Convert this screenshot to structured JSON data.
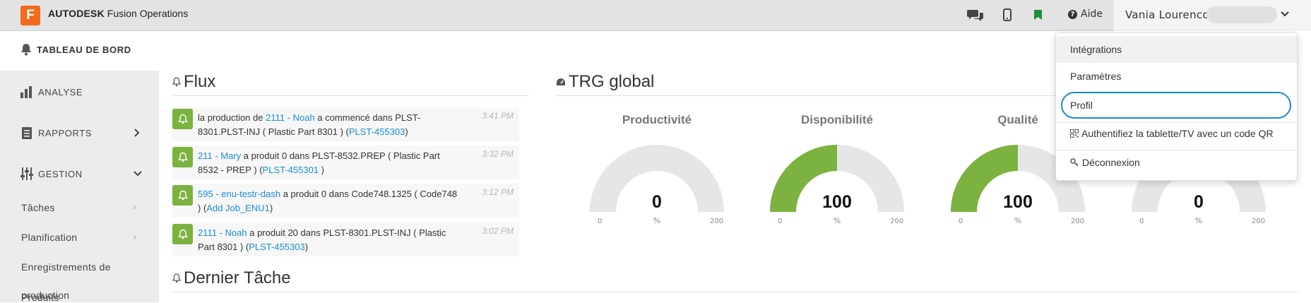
{
  "app": {
    "logo_letter": "F",
    "brand_bold": "AUTODESK",
    "brand_rest": " Fusion Operations"
  },
  "topbar": {
    "help_label": "Aide",
    "user_name": "Vania Lourenco",
    "icons": [
      "chat-icon",
      "mobile-icon",
      "bookmark-icon",
      "help-icon",
      "chevron-down-icon"
    ]
  },
  "sidebar": {
    "dashboard": "TABLEAU DE BORD",
    "analyse": "ANALYSE",
    "rapports": "RAPPORTS",
    "gestion": "GESTION",
    "sub": [
      "Tâches",
      "Planification",
      "Enregistrements de",
      "production",
      "Produits"
    ]
  },
  "feed": {
    "title": "Flux",
    "items": [
      {
        "pre": "la production de ",
        "link1": "2111 - Noah",
        "mid": " a commencé dans PLST-8301.PLST-INJ ( Plastic Part 8301 ) (",
        "link2": "PLST-455303",
        "post": ")",
        "time": "3:41 PM"
      },
      {
        "pre": "",
        "link1": "211 - Mary",
        "mid": " a produit 0 dans PLST-8532.PREP ( Plastic Part 8532 - PREP ) (",
        "link2": "PLST-455301",
        "post": " )",
        "time": "3:32 PM"
      },
      {
        "pre": "",
        "link1": "595 - enu-testr-dash",
        "mid": " a produit 0 dans Code748.1325 ( Code748 ) (",
        "link2": "Add Job_ENU1",
        "post": ")",
        "time": "3:12 PM"
      },
      {
        "pre": "",
        "link1": "2111 - Noah",
        "mid": " a produit 20 dans PLST-8301.PLST-INJ ( Plastic Part 8301 ) (",
        "link2": "PLST-455303",
        "post": ")",
        "time": "3:02 PM"
      }
    ]
  },
  "trg": {
    "title": "TRG global",
    "gauges": [
      {
        "title": "Productivité",
        "value": "0",
        "fraction": 0.0,
        "unit": "%",
        "min": "0",
        "max": "200"
      },
      {
        "title": "Disponibilité",
        "value": "100",
        "fraction": 0.5,
        "unit": "%",
        "min": "0",
        "max": "200"
      },
      {
        "title": "Qualité",
        "value": "100",
        "fraction": 0.5,
        "unit": "%",
        "min": "0",
        "max": "200"
      },
      {
        "title": "",
        "value": "0",
        "fraction": 0.0,
        "unit": "%",
        "min": "0",
        "max": "200"
      }
    ]
  },
  "last_task": {
    "title": "Dernier Tâche"
  },
  "dropdown": {
    "items": [
      "Intégrations",
      "Paramètres",
      "Profil",
      "Authentifiez la tablette/TV avec un code QR",
      "Déconnexion"
    ]
  },
  "colors": {
    "accent": "#1a8fd0",
    "gauge_fill": "#7bb240",
    "gauge_bg": "#e6e6e6",
    "logo": "#f26b1d",
    "bookmark": "#1e8f3a"
  }
}
